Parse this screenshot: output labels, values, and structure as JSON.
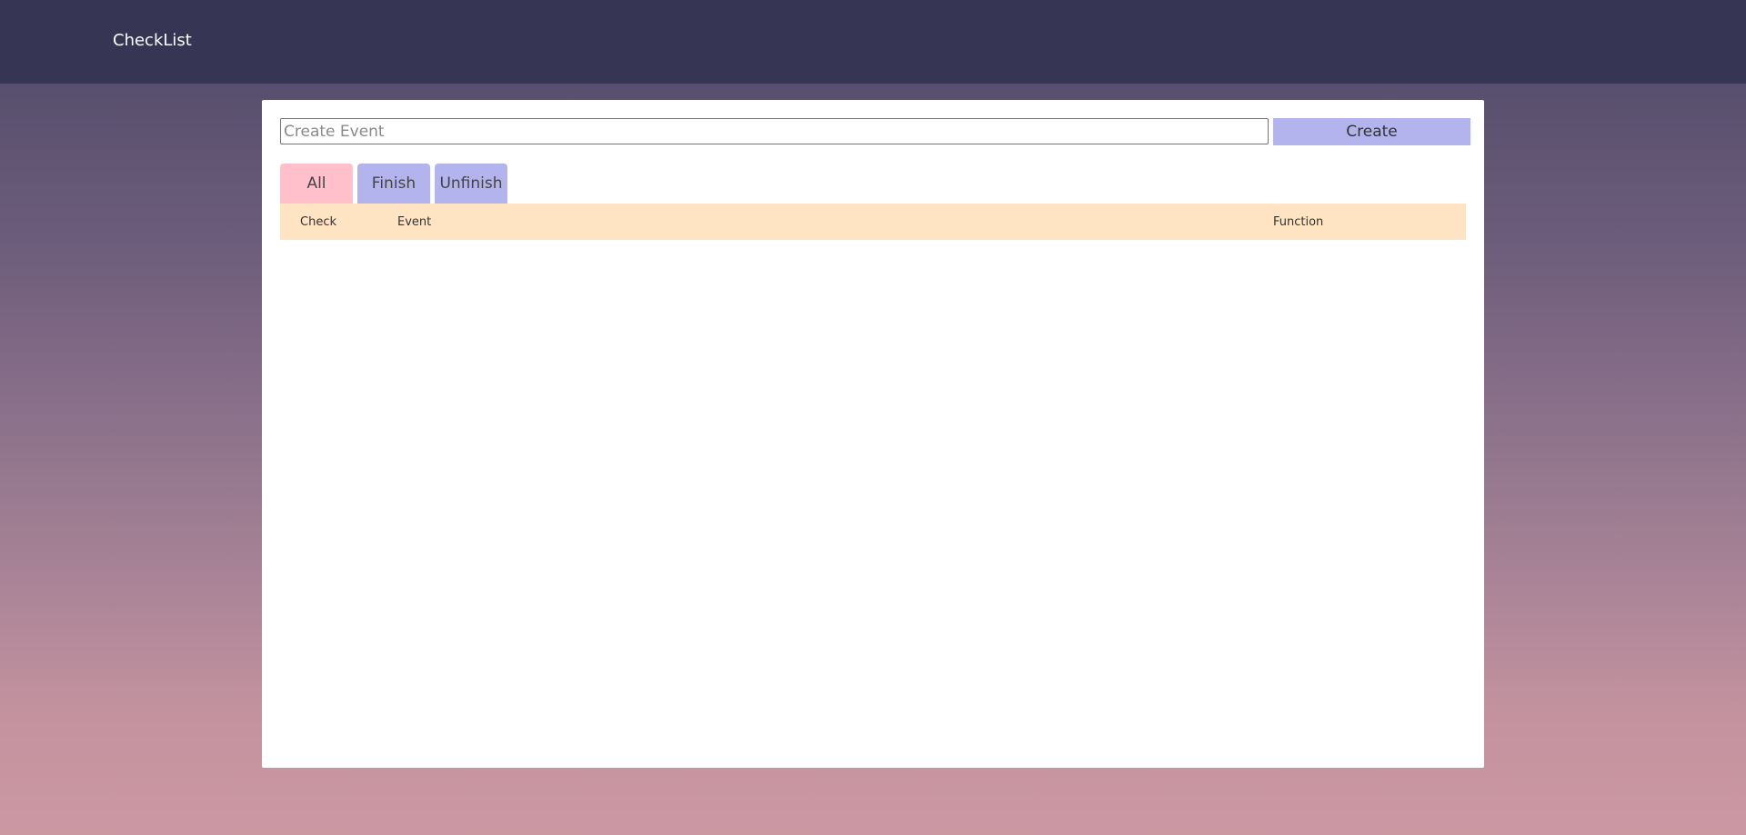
{
  "header": {
    "title": "CheckList"
  },
  "create": {
    "placeholder": "Create Event",
    "value": "",
    "button_label": "Create"
  },
  "tabs": [
    {
      "label": "All",
      "active": true
    },
    {
      "label": "Finish",
      "active": false
    },
    {
      "label": "Unfinish",
      "active": false
    }
  ],
  "table": {
    "columns": [
      "Check",
      "Event",
      "Function"
    ],
    "rows": []
  },
  "colors": {
    "topbar": "#363553",
    "active_tab": "#ffc0cb",
    "inactive_tab": "#b3b3ee",
    "create_button": "#b3b3ee",
    "table_header": "#ffe4c4"
  }
}
